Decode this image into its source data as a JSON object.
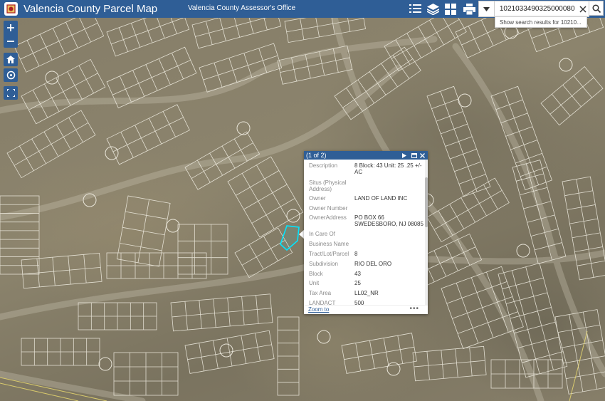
{
  "header": {
    "app_title": "Valencia County Parcel Map",
    "subtitle": "Valencia County Assessor's Office",
    "icons": [
      "legend-icon",
      "layers-icon",
      "basemap-gallery-icon",
      "print-icon"
    ]
  },
  "search": {
    "value": "1021033490325000080",
    "suggestion": "Show search results for 10210..."
  },
  "map_controls": [
    "zoom-in",
    "zoom-out",
    "home",
    "locate",
    "fullscreen"
  ],
  "popup": {
    "pager": "(1 of 2)",
    "fields": [
      {
        "label": "Description",
        "value": "8 Block: 43 Unit: 25 .25 +/- AC"
      },
      {
        "label": "Situs (Physical Address)",
        "value": ""
      },
      {
        "label": "Owner",
        "value": "LAND OF LAND INC"
      },
      {
        "label": "Owner Number",
        "value": ""
      },
      {
        "label": "OwnerAddress",
        "value": "PO BOX 66 SWEDESBORO, NJ 08085"
      },
      {
        "label": "In Care Of",
        "value": ""
      },
      {
        "label": "Business Name",
        "value": ""
      },
      {
        "label": "Tract/Lot/Parcel",
        "value": "8"
      },
      {
        "label": "Subdivision",
        "value": "RIO DEL ORO"
      },
      {
        "label": "Block",
        "value": "43"
      },
      {
        "label": "Unit",
        "value": "25"
      },
      {
        "label": "Tax Area",
        "value": "LL02_NR"
      },
      {
        "label": "LANDACT",
        "value": "500"
      }
    ],
    "zoom_to": "Zoom to",
    "more": "•••"
  },
  "colors": {
    "header": "#2f5e96",
    "parcel_lines": "#ffffff",
    "selected_parcel": "#00e5ff"
  }
}
